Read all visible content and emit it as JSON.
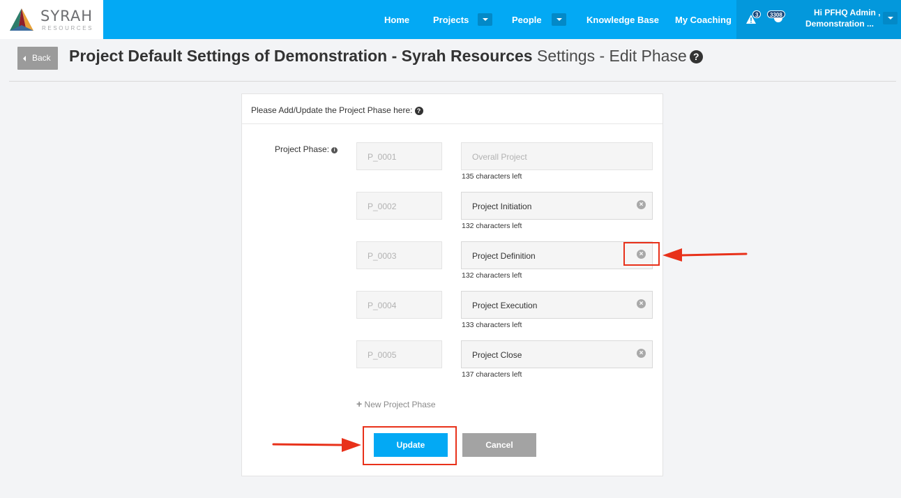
{
  "brand": {
    "name": "SYRAH",
    "tagline": "RESOURCES",
    "colors": {
      "primary": "#03a9f4",
      "nav_dark": "#0398dc",
      "annotation": "#e8311a"
    }
  },
  "nav": {
    "items": [
      {
        "label": "Home"
      },
      {
        "label": "Projects"
      },
      {
        "label": "People"
      },
      {
        "label": "Knowledge Base"
      },
      {
        "label": "My Coaching"
      }
    ],
    "alerts_count": "3",
    "coaching_count": "3308",
    "user_line1": "Hi PFHQ Admin ,",
    "user_line2": "Demonstration ..."
  },
  "header": {
    "back_label": "Back",
    "title_bold": "Project Default Settings of Demonstration - Syrah Resources",
    "title_rest": "Settings - Edit Phase",
    "help_glyph": "?"
  },
  "form": {
    "heading": "Please Add/Update the Project Phase here:",
    "help_glyph": "?",
    "field_label": "Project Phase:",
    "info_glyph": "i",
    "phases": [
      {
        "code": "P_0001",
        "name": "Overall Project",
        "chars_left": "135 characters left"
      },
      {
        "code": "P_0002",
        "name": "Project Initiation",
        "chars_left": "132 characters left"
      },
      {
        "code": "P_0003",
        "name": "Project Definition",
        "chars_left": "132 characters left"
      },
      {
        "code": "P_0004",
        "name": "Project Execution",
        "chars_left": "133 characters left"
      },
      {
        "code": "P_0005",
        "name": "Project Close",
        "chars_left": "137 characters left"
      }
    ],
    "clear_glyph": "×",
    "add_glyph": "+",
    "add_label": "New Project Phase",
    "update_label": "Update",
    "cancel_label": "Cancel"
  }
}
